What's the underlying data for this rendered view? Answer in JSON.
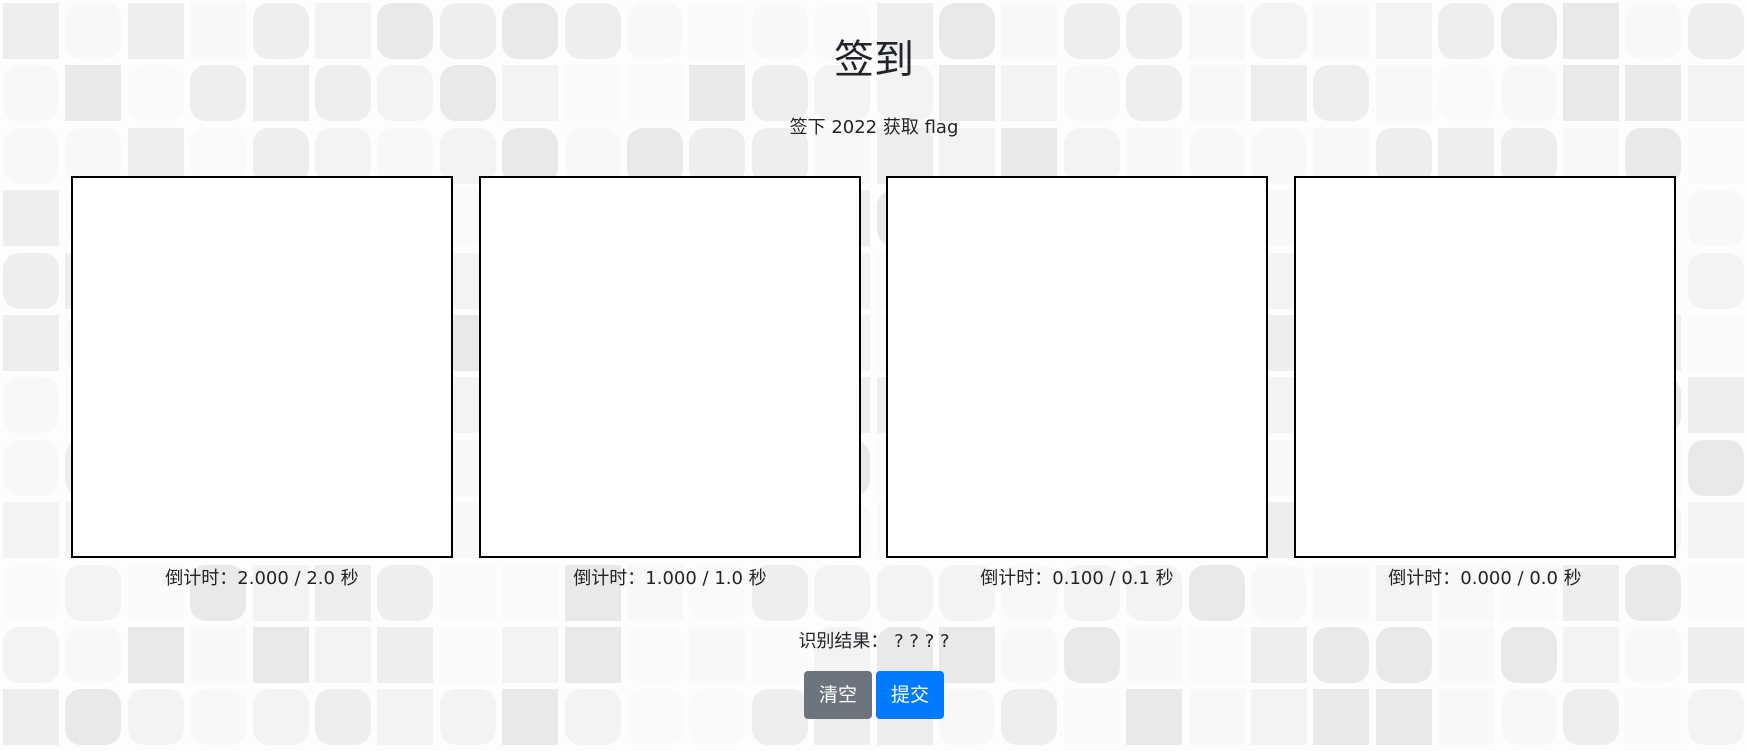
{
  "page": {
    "title": "签到",
    "subtitle": "签下 2022 获取 flag"
  },
  "canvases": [
    {
      "countdown": "倒计时：2.000 / 2.0 秒"
    },
    {
      "countdown": "倒计时：1.000 / 1.0 秒"
    },
    {
      "countdown": "倒计时：0.100 / 0.1 秒"
    },
    {
      "countdown": "倒计时：0.000 / 0.0 秒"
    }
  ],
  "result": {
    "label": "识别结果： ? ? ? ?"
  },
  "buttons": {
    "clear_label": "清空",
    "submit_label": "提交"
  },
  "colors": {
    "clear_button": "#6c757d",
    "submit_button": "#007bff",
    "canvas_border": "#000000",
    "canvas_fill": "#ffffff",
    "tile_shades": [
      "#f8f8f8",
      "#f3f3f3",
      "#eeeeee",
      "#e9e9e9",
      "#fafafa"
    ]
  }
}
